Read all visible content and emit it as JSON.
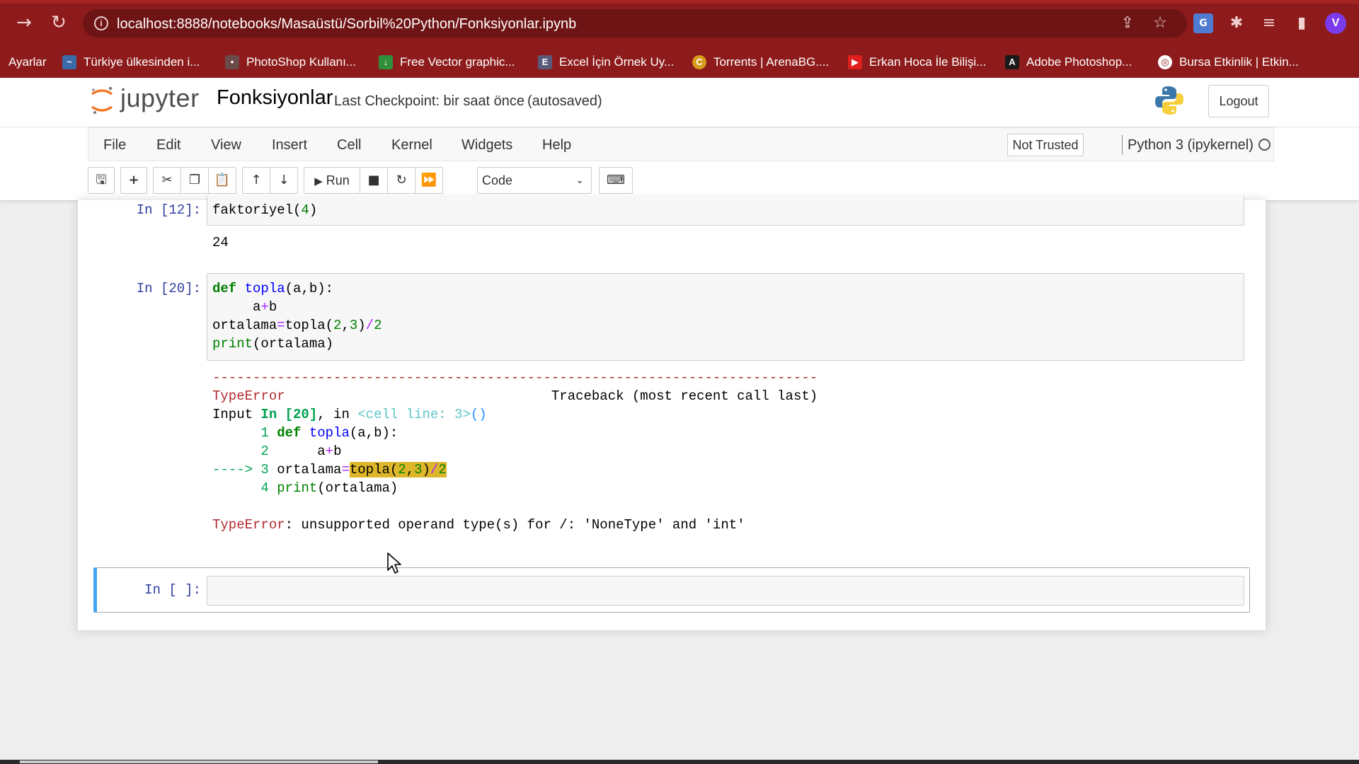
{
  "browser": {
    "url": "localhost:8888/notebooks/Masaüstü/Sorbil%20Python/Fonksiyonlar.ipynb",
    "profile_initial": "V",
    "bookmarks": [
      {
        "label": "Ayarlar"
      },
      {
        "label": "Türkiye ülkesinden i..."
      },
      {
        "label": "PhotoShop Kullanı..."
      },
      {
        "label": "Free Vector graphic..."
      },
      {
        "label": "Excel İçin Örnek Uy..."
      },
      {
        "label": "Torrents | ArenaBG...."
      },
      {
        "label": "Erkan Hoca İle Bilişi..."
      },
      {
        "label": "Adobe Photoshop..."
      },
      {
        "label": "Bursa Etkinlik | Etkin..."
      }
    ]
  },
  "header": {
    "logo_text": "jupyter",
    "notebook_name": "Fonksiyonlar",
    "checkpoint": "Last Checkpoint: bir saat önce",
    "autosave": "(autosaved)",
    "logout_label": "Logout"
  },
  "menubar": {
    "items": [
      "File",
      "Edit",
      "View",
      "Insert",
      "Cell",
      "Kernel",
      "Widgets",
      "Help"
    ],
    "trust_label": "Not Trusted",
    "kernel_name": "Python 3 (ipykernel)"
  },
  "toolbar": {
    "run_label": "Run",
    "cell_type": "Code"
  },
  "cells": {
    "c12": {
      "prompt": "In [12]:",
      "output": "24"
    },
    "c20": {
      "prompt": "In [20]:"
    },
    "empty": {
      "prompt": "In [ ]:"
    }
  },
  "traceback": {
    "dashes": "---------------------------------------------------------------------------",
    "error_type": "TypeError",
    "header_right": "Traceback (most recent call last)",
    "input_label": "Input ",
    "input_ref": "In [20]",
    "input_in": ", in ",
    "cell_line": "<cell line: 3>",
    "paren": "()",
    "final_message": ": unsupported operand type(s) for /: 'NoneType' and 'int'"
  },
  "colors": {
    "chrome": "#8e1b1b",
    "prompt_blue": "#303f9f",
    "selected_cell_border": "#42a5f5",
    "error_red": "#b22b31",
    "highlight": "#ddb62b"
  }
}
